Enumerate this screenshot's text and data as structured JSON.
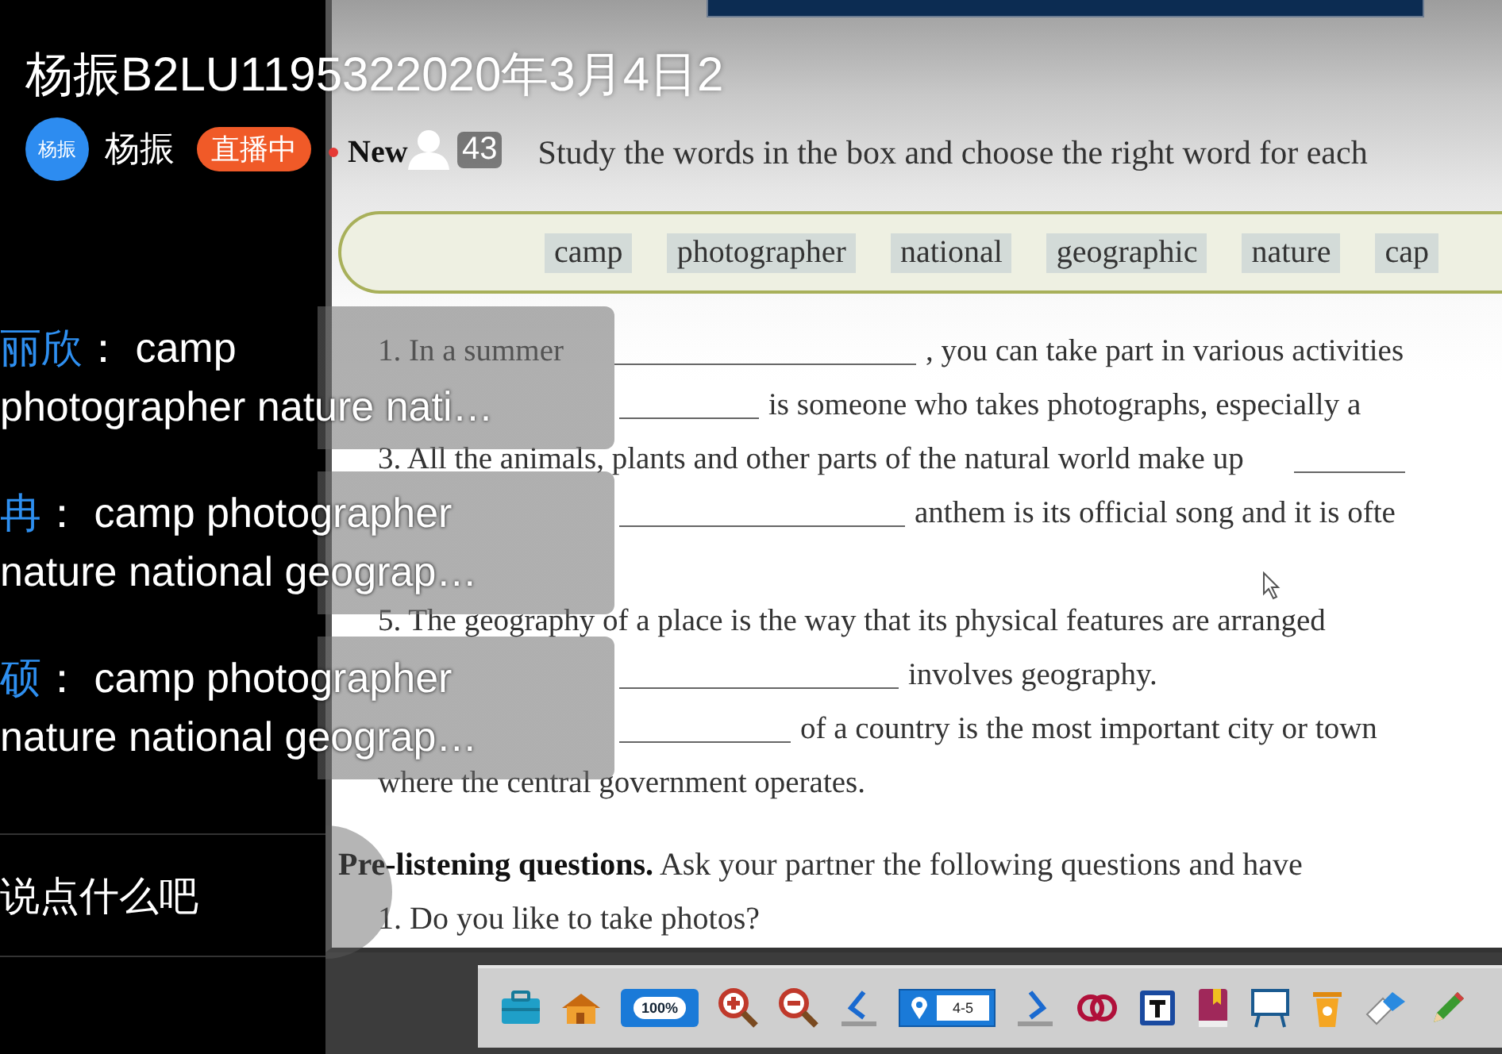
{
  "stream": {
    "title": "杨振B2LU1195322020年3月4日2",
    "host": {
      "avatar_text": "杨振",
      "name": "杨振"
    },
    "live_badge": "直播中",
    "viewer_count": "43"
  },
  "chat": {
    "messages": [
      {
        "user": "丽欣",
        "lines": [
          "：  camp",
          "photographer nature nati…"
        ]
      },
      {
        "user": "冉",
        "lines": [
          "： camp photographer",
          "nature national geograp…"
        ]
      },
      {
        "user": "硕",
        "lines": [
          "： camp photographer",
          "nature national geograp…"
        ]
      }
    ],
    "input": {
      "placeholder": "说点什么吧"
    }
  },
  "document": {
    "heading": "New",
    "instruction": "Study the words in the box and choose the right word for each",
    "word_box": [
      "camp",
      "photographer",
      "national",
      "geographic",
      "nature",
      "cap"
    ],
    "lines": [
      {
        "parts": [
          {
            "kind": "text",
            "text": "1.  In a summer"
          },
          {
            "kind": "blank"
          },
          {
            "kind": "text",
            "text": ", you can take part in various activities"
          }
        ]
      },
      {
        "parts": [
          {
            "kind": "blank"
          },
          {
            "kind": "text",
            "text": "is someone who takes photographs, especially a"
          }
        ]
      },
      {
        "parts": [
          {
            "kind": "text",
            "text": "3.  All the animals, plants and other parts of the natural world make up"
          },
          {
            "kind": "blank"
          }
        ]
      },
      {
        "parts": [
          {
            "kind": "blank"
          },
          {
            "kind": "text",
            "text": "anthem is its official song and it is ofte"
          }
        ]
      },
      {
        "parts": [
          {
            "kind": "text",
            "text": "5.  The geography of a place is the way that its physical features are arranged"
          }
        ]
      },
      {
        "parts": [
          {
            "kind": "blank"
          },
          {
            "kind": "text",
            "text": "involves geography."
          }
        ]
      },
      {
        "parts": [
          {
            "kind": "blank"
          },
          {
            "kind": "text",
            "text": "of a country is the most important city or town"
          }
        ]
      },
      {
        "parts": [
          {
            "kind": "indent"
          },
          {
            "kind": "text",
            "text": "where the central government operates."
          }
        ]
      }
    ],
    "pre_listening": {
      "title": "Pre-listening questions.",
      "text": "Ask your partner the following questions and have"
    },
    "question": "1.  Do you like to take photos?"
  },
  "toolbar": {
    "zoom_level": "100%",
    "page": "4-5"
  }
}
